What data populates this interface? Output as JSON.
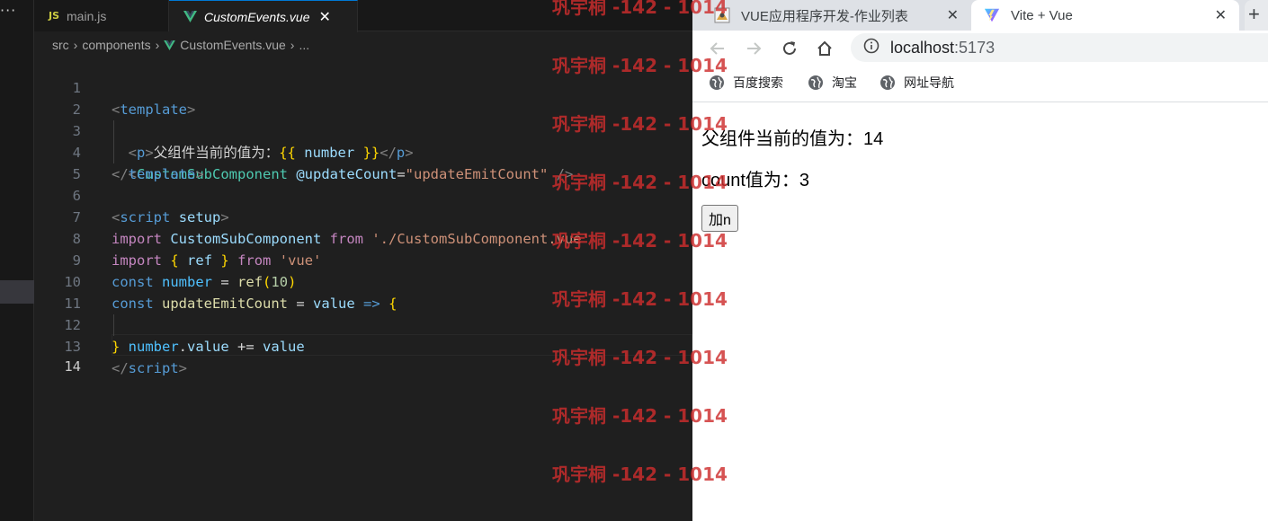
{
  "editor": {
    "more_actions": "···",
    "tabs": [
      {
        "icon": "JS",
        "label": "main.js"
      },
      {
        "label": "CustomEvents.vue",
        "close": "✕"
      }
    ],
    "breadcrumb": [
      "src",
      "components",
      "CustomEvents.vue",
      "..."
    ],
    "line_numbers": [
      "1",
      "2",
      "3",
      "4",
      "5",
      "6",
      "7",
      "8",
      "9",
      "10",
      "11",
      "12",
      "13",
      "14"
    ]
  },
  "browser": {
    "tabs": [
      {
        "title": "VUE应用程序开发-作业列表",
        "close": "✕"
      },
      {
        "title": "Vite + Vue",
        "close": "✕"
      }
    ],
    "new_tab": "+",
    "url_host": "localhost",
    "url_port": ":5173",
    "bookmarks": [
      "百度搜索",
      "淘宝",
      "网址导航"
    ],
    "page": {
      "parent_line": "父组件当前的值为：14",
      "count_line": "count值为：3",
      "button": "加n"
    }
  },
  "watermark": "巩宇桐 -142 - 1014",
  "colors": {
    "vscode_bg": "#1f1f1f",
    "accent_blue": "#0078d4",
    "vue_green": "#41b883",
    "watermark_red": "#cd2d2d"
  }
}
